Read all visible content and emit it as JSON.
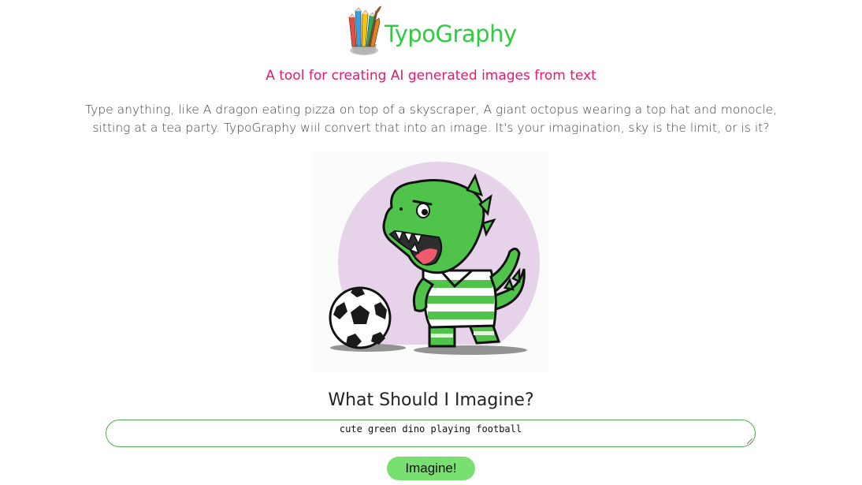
{
  "header": {
    "logo_icon": "pencils-and-brush-icon",
    "title": "TypoGraphy",
    "tagline": "A tool for creating AI generated images from text"
  },
  "intro": {
    "line1": "Type anything, like A dragon eating pizza on top of a skyscraper, A giant octopus wearing a top hat and monocle,",
    "line2": "sitting at a tea party. TypoGraphy wiil convert that into an image. It's your imagination, sky is the limit, or is it?"
  },
  "result": {
    "image_subject": "dino-playing-football-illustration"
  },
  "form": {
    "question": "What Should I Imagine?",
    "prompt_value": "cute green dino playing football",
    "submit_label": "Imagine!"
  },
  "colors": {
    "title_green": "#2ecc40",
    "tagline_pink": "#e8186d",
    "button_green": "#78e070",
    "input_border": "#4caf50",
    "dino_green": "#4fc34a"
  }
}
